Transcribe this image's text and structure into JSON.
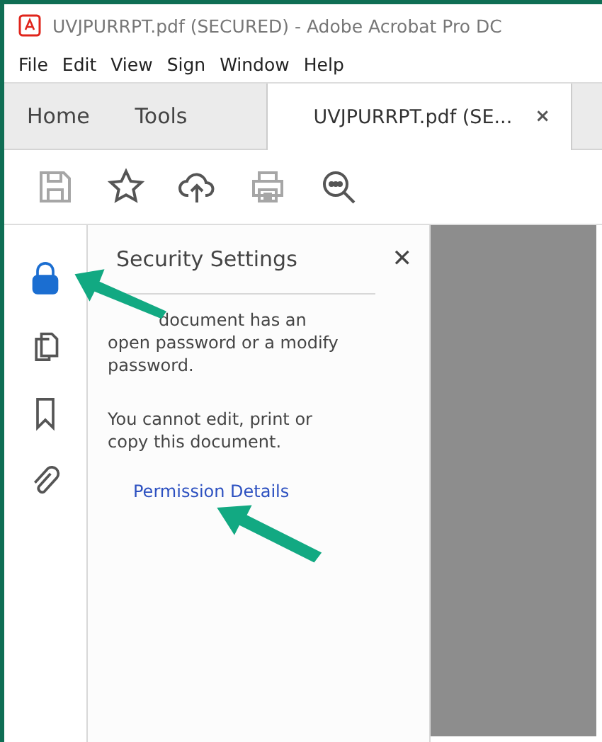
{
  "window": {
    "title": "UVJPURRPT.pdf (SECURED) - Adobe Acrobat Pro DC"
  },
  "menu": [
    "File",
    "Edit",
    "View",
    "Sign",
    "Window",
    "Help"
  ],
  "tabs": [
    {
      "label": "Home",
      "selected": false
    },
    {
      "label": "Tools",
      "selected": false
    },
    {
      "label": "UVJPURRPT.pdf (SE...",
      "selected": true,
      "close": "×"
    }
  ],
  "toolbar": [
    {
      "kind": "save",
      "disabled": true
    },
    {
      "kind": "star",
      "disabled": false
    },
    {
      "kind": "upload",
      "disabled": false
    },
    {
      "kind": "print",
      "disabled": true
    },
    {
      "kind": "find",
      "disabled": false
    }
  ],
  "rail": [
    {
      "kind": "lock",
      "selected": true
    },
    {
      "kind": "pages",
      "selected": false
    },
    {
      "kind": "bookmark",
      "selected": false
    },
    {
      "kind": "attachment",
      "selected": false
    }
  ],
  "panel": {
    "title": "Security Settings",
    "close": "✕",
    "paragraphs": [
      "document has an open password or a modify password.",
      "You cannot edit, print or copy this document."
    ],
    "link": "Permission Details"
  }
}
